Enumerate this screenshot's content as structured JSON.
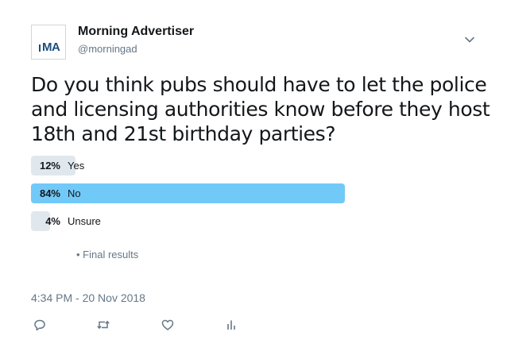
{
  "author": {
    "display_name": "Morning Advertiser",
    "handle": "@morningad",
    "avatar_text": "MA"
  },
  "tweet": {
    "text": "Do you think pubs should have to let the police and licensing authorities know before they host 18th and 21st birthday parties?",
    "timestamp": "4:34 PM - 20 Nov 2018"
  },
  "poll": {
    "choices": [
      {
        "label": "Yes",
        "percent": "12%",
        "value": 12
      },
      {
        "label": "No",
        "percent": "84%",
        "value": 84
      },
      {
        "label": "Unsure",
        "percent": "4%",
        "value": 4
      }
    ],
    "status": "• Final results"
  },
  "colors": {
    "winner_bar": "#71c9f8",
    "other_bar": "#e1e8ed",
    "secondary_text": "#657786"
  },
  "icons": {
    "menu": "chevron-down-icon",
    "reply": "reply-icon",
    "retweet": "retweet-icon",
    "like": "heart-icon",
    "analytics": "analytics-icon"
  }
}
